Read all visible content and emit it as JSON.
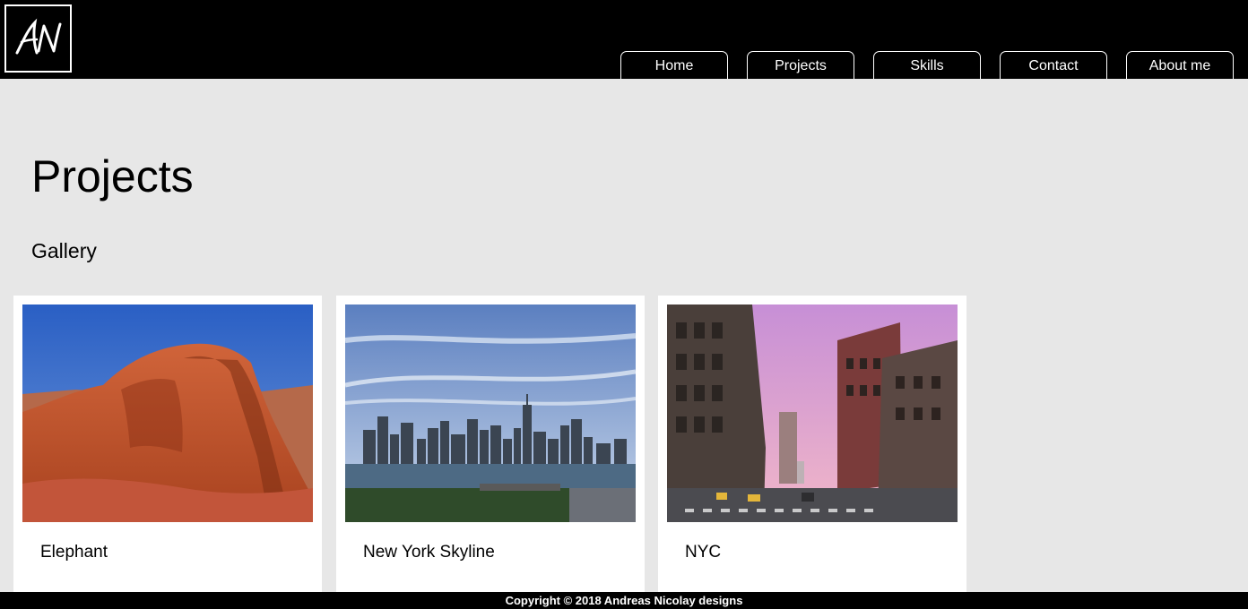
{
  "header": {
    "logo_text": "AN",
    "nav": [
      {
        "label": "Home"
      },
      {
        "label": "Projects"
      },
      {
        "label": "Skills"
      },
      {
        "label": "Contact"
      },
      {
        "label": "About me"
      }
    ]
  },
  "main": {
    "title": "Projects",
    "section_title": "Gallery",
    "gallery": [
      {
        "caption": "Elephant",
        "image": "red-rock-arch-photo"
      },
      {
        "caption": "New York Skyline",
        "image": "city-skyline-photo"
      },
      {
        "caption": "NYC",
        "image": "city-street-sunset-photo"
      }
    ]
  },
  "footer": {
    "copyright": "Copyright © 2018 Andreas Nicolay designs"
  },
  "colors": {
    "header_bg": "#000000",
    "page_bg": "#e7e7e7",
    "card_bg": "#ffffff",
    "nav_border": "#ffffff"
  }
}
